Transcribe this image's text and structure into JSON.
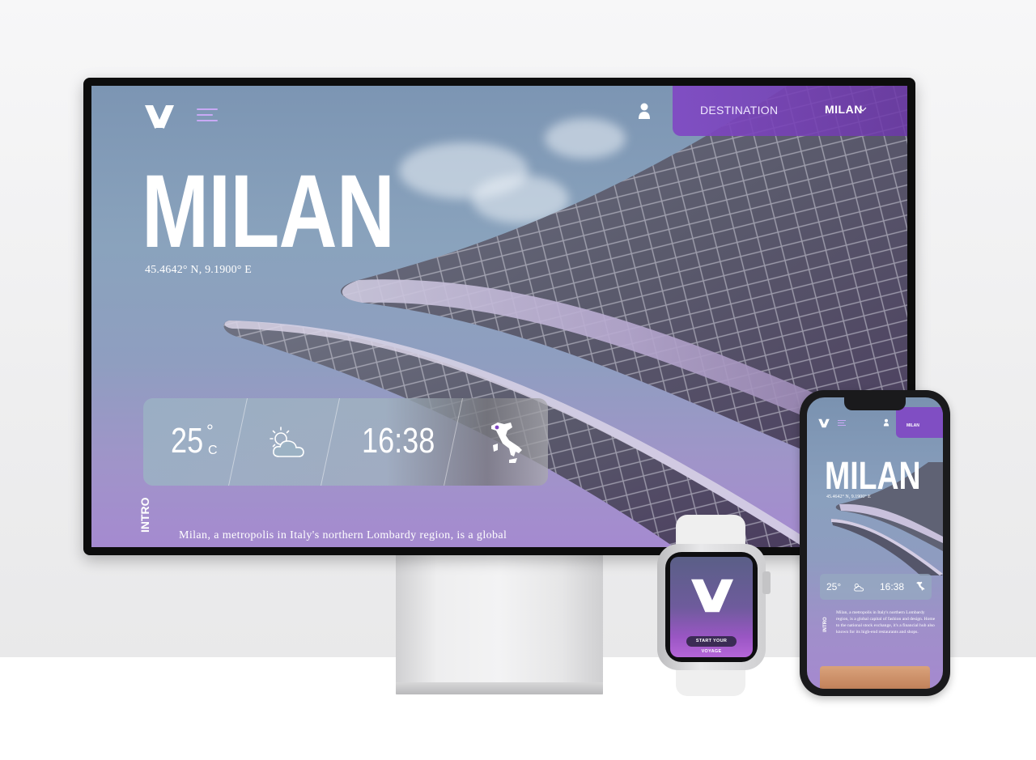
{
  "desktop": {
    "header": {
      "destination_label": "DESTINATION",
      "destination_value": "MILAN"
    },
    "hero": {
      "title": "MILAN",
      "coordinates": "45.4642° N, 9.1900° E"
    },
    "weather_card": {
      "temperature": "25",
      "degree_symbol": "°",
      "unit": "C",
      "time": "16:38"
    },
    "intro": {
      "label": "INTRO",
      "text": "Milan, a metropolis in Italy's northern Lombardy region, is a global"
    }
  },
  "watch": {
    "button_label": "START YOUR VOYAGE"
  },
  "phone": {
    "header": {
      "destination_value": "MILAN"
    },
    "hero": {
      "title": "MILAN",
      "coordinates": "45.4642° N, 9.1900° E"
    },
    "weather_card": {
      "temperature": "25°",
      "time": "16:38"
    },
    "intro": {
      "label": "INTRO",
      "text": "Milan, a metropolis in Italy's northern Lombardy region, is a global capital of fashion and design. Home to the national stock exchange, it's a financial hub also known for its high-end restaurants and shops."
    }
  },
  "colors": {
    "accent_purple": "#8048c4",
    "menu_lilac": "#c8a9f5"
  },
  "icons": [
    "v-logo-icon",
    "menu-icon",
    "user-icon",
    "chevron-down-icon",
    "partly-cloudy-icon",
    "italy-map-icon"
  ]
}
